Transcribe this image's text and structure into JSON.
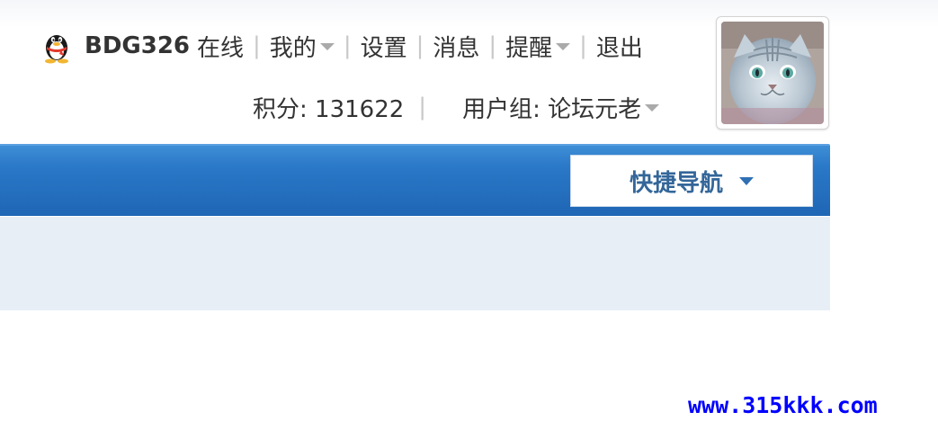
{
  "user": {
    "username": "BDG326",
    "status": "在线",
    "menu": {
      "mine": "我的",
      "settings": "设置",
      "messages": "消息",
      "reminders": "提醒",
      "logout": "退出"
    },
    "separator": "|",
    "points_label": "积分: ",
    "points_value": "131622",
    "group_label": "用户组: ",
    "group_value": "论坛元老"
  },
  "nav": {
    "quick_nav_label": "快捷导航"
  },
  "watermark": {
    "text": "www.315kkk.com",
    "color": "#0000ff"
  },
  "colors": {
    "nav_bar": "#2a78c8",
    "sub_bar": "#e8eef5",
    "quick_nav_text": "#336699"
  },
  "icons": {
    "qq": "qq-penguin-icon",
    "avatar": "cat-avatar"
  }
}
